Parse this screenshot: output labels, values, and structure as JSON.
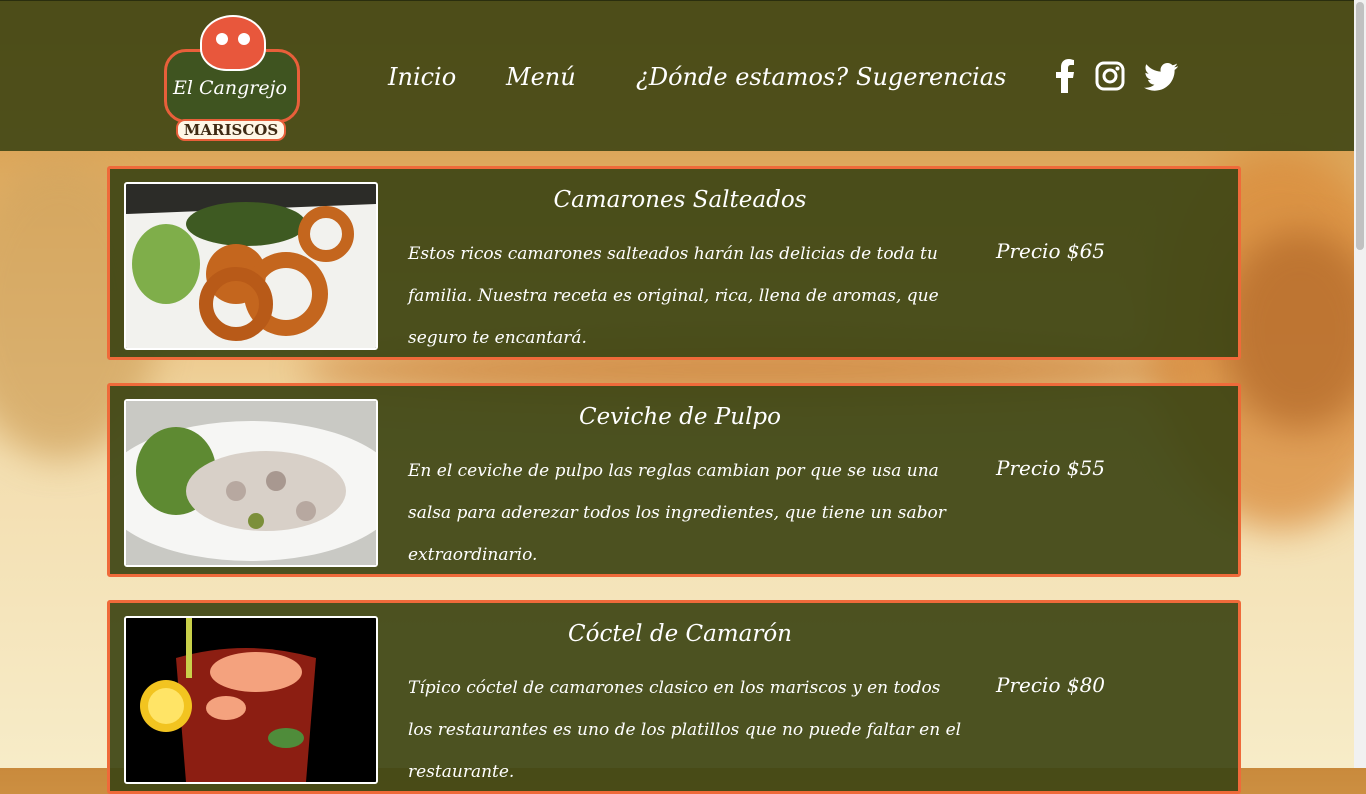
{
  "brand": {
    "name": "El Cangrejo",
    "tagline": "MARISCOS"
  },
  "nav": {
    "items": [
      {
        "label": "Inicio"
      },
      {
        "label": "Menú"
      },
      {
        "label": "¿Dónde estamos?"
      },
      {
        "label": "Sugerencias"
      }
    ]
  },
  "social": {
    "facebook_icon": "facebook-icon",
    "instagram_icon": "instagram-icon",
    "twitter_icon": "twitter-icon"
  },
  "colors": {
    "header_bg": "#424816",
    "card_border": "#ef6a3a",
    "card_bg": "#3e4614"
  },
  "menu": [
    {
      "title": "Camarones Salteados",
      "description": "Estos ricos camarones salteados harán las delicias de toda tu familia. Nuestra receta es original, rica, llena de aromas, que seguro te encantará.",
      "price": "Precio $65"
    },
    {
      "title": "Ceviche de Pulpo",
      "description": "En el ceviche de pulpo las reglas cambian por que se usa una salsa para aderezar todos los ingredientes, que tiene un sabor extraordinario.",
      "price": "Precio $55"
    },
    {
      "title": "Cóctel de Camarón",
      "description": "Típico cóctel de camarones clasico en los mariscos y en todos los restaurantes es uno de los platillos que no puede faltar en el restaurante.",
      "price": "Precio $80"
    }
  ]
}
